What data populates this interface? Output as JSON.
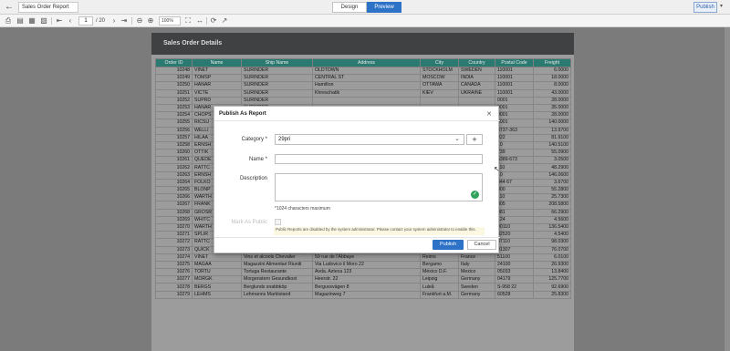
{
  "app": {
    "title": "Sales Order Report",
    "mode_design": "Design",
    "mode_preview": "Preview",
    "publish": "Publish"
  },
  "toolbar": {
    "page_current": "1",
    "page_total": "/ 20",
    "zoom": "100%"
  },
  "report": {
    "title": "Sales Order Details",
    "columns": [
      "Order ID",
      "Name",
      "Ship Name",
      "Address",
      "City",
      "Country",
      "Postal Code",
      "Freight"
    ],
    "rows": [
      [
        "10248",
        "VINET",
        "SURINDER",
        "OLDTOWN",
        "STOCKHOLM",
        "SWEDEN",
        "110001",
        "6.0000"
      ],
      [
        "10249",
        "TOMSP",
        "SURINDER",
        "CENTRAL ST",
        "MOSCOW",
        "INDIA",
        "110001",
        "18.0000"
      ],
      [
        "10250",
        "HANAR",
        "SURINDER",
        "Hamilton",
        "OTTAWA",
        "CANADA",
        "110001",
        "8.0000"
      ],
      [
        "10251",
        "VICTE",
        "SURINDER",
        "Khreschatik",
        "KIEV",
        "UKRAINE",
        "110001",
        "43.0000"
      ],
      [
        "10252",
        "SUPRD",
        "SURINDER",
        "",
        "",
        "",
        "0001",
        "28.0000"
      ],
      [
        "10253",
        "HANAR",
        "SURINDER",
        "",
        "",
        "",
        "0001",
        "35.0000"
      ],
      [
        "10254",
        "CHOPS",
        "",
        "",
        "",
        "",
        "0001",
        "28.0000"
      ],
      [
        "10255",
        "RICSU",
        "",
        "",
        "",
        "",
        "0001",
        "140.0000"
      ],
      [
        "10256",
        "WELLI",
        "",
        "",
        "",
        "",
        "8737-363",
        "13.9700"
      ],
      [
        "10257",
        "HILAA",
        "",
        "",
        "",
        "",
        "022",
        "81.9100"
      ],
      [
        "10258",
        "ERNSH",
        "",
        "",
        "",
        "",
        "10",
        "140.5100"
      ],
      [
        "10260",
        "OTTIK",
        "",
        "",
        "",
        "",
        "739",
        "55.0900"
      ],
      [
        "10261",
        "QUEDE",
        "",
        "",
        "",
        "",
        "5389-673",
        "3.0500"
      ],
      [
        "10262",
        "RATTC",
        "",
        "",
        "",
        "",
        "110",
        "48.2900"
      ],
      [
        "10263",
        "ERNSH",
        "",
        "",
        "",
        "",
        "10",
        "146.0600"
      ],
      [
        "10264",
        "FOLKO",
        "",
        "",
        "",
        "",
        "844 67",
        "3.6700"
      ],
      [
        "10265",
        "BLONP",
        "",
        "",
        "",
        "",
        "000",
        "55.2800"
      ],
      [
        "10266",
        "WARTH",
        "",
        "",
        "",
        "",
        "110",
        "25.7300"
      ],
      [
        "10267",
        "FRANK",
        "",
        "",
        "",
        "",
        "805",
        "208.5800"
      ],
      [
        "10268",
        "GROSR",
        "",
        "",
        "",
        "",
        "081",
        "66.2900"
      ],
      [
        "10269",
        "WHITC",
        "",
        "",
        "",
        "",
        "124",
        "4.5600"
      ],
      [
        "10270",
        "WARTH",
        "Wartian Herkku",
        "Torikatu 38",
        "Oulu",
        "Finland",
        "90110",
        "136.5400"
      ],
      [
        "10271",
        "SPLIR",
        "Split Rail Beer & Ale",
        "P.O. Box 555",
        "Lander",
        "USA",
        "82520",
        "4.5400"
      ],
      [
        "10272",
        "RATTC",
        "Rattlesnake Canyon Grocery",
        "2817 Milton Dr.",
        "Albuquerque",
        "USA",
        "87110",
        "98.0300"
      ],
      [
        "10273",
        "QUICK",
        "QUICK-Stop",
        "Taucherstraße 10",
        "Cunewalde",
        "Germany",
        "01307",
        "76.0700"
      ],
      [
        "10274",
        "VINET",
        "Vins et alcools Chevalier",
        "59 rue de l'Abbaye",
        "Reims",
        "France",
        "51100",
        "6.0100"
      ],
      [
        "10275",
        "MAGAA",
        "Magazzini Alimentari Riuniti",
        "Via Ludovico il Moro 22",
        "Bergamo",
        "Italy",
        "24100",
        "26.9300"
      ],
      [
        "10276",
        "TORTU",
        "Tortuga Restaurante",
        "Avda. Azteca 123",
        "México D.F.",
        "Mexico",
        "05033",
        "13.8400"
      ],
      [
        "10277",
        "MORGK",
        "Morgenstern Gesundkost",
        "Heerstr. 22",
        "Leipzig",
        "Germany",
        "04179",
        "125.7700"
      ],
      [
        "10278",
        "BERGS",
        "Berglunds snabbköp",
        "Berguvsvägen 8",
        "Luleå",
        "Sweden",
        "S-958 22",
        "92.6900"
      ],
      [
        "10279",
        "LEHMS",
        "Lehmanns Marktstand",
        "Magazinweg 7",
        "Frankfurt a.M.",
        "Germany",
        "60528",
        "25.8300"
      ]
    ]
  },
  "dialog": {
    "title": "Publish As Report",
    "category_label": "Category *",
    "category_value": "29pri",
    "name_label": "Name *",
    "description_label": "Description",
    "char_hint": "*1024 characters maximum",
    "mark_public_label": "Mark As Public",
    "public_note": "Public Reports are disabled by the system administrator. Please contact your system administrator to enable this.",
    "publish_button": "Publish",
    "cancel_button": "Cancel"
  }
}
